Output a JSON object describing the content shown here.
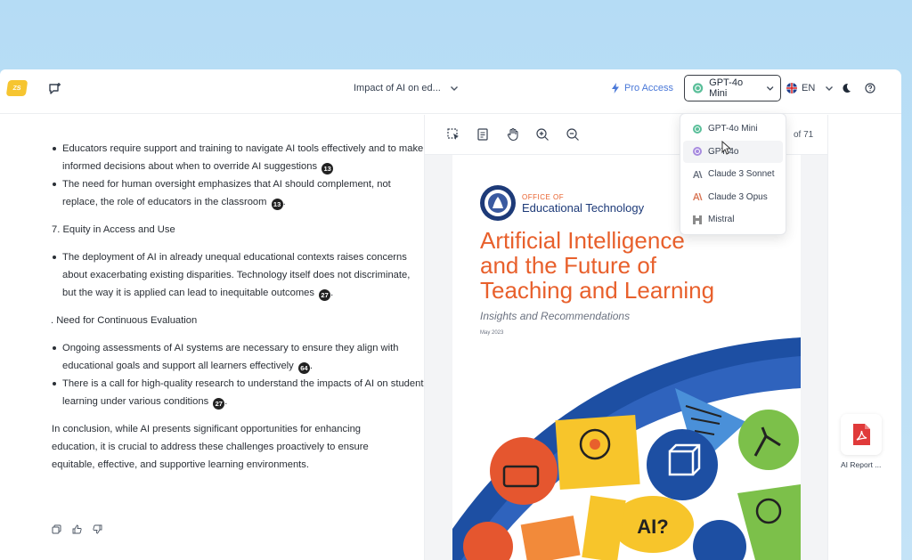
{
  "header": {
    "logo_text": "ZS",
    "conversation_title": "Impact of AI on ed...",
    "pro_access": "Pro Access",
    "model_selected": "GPT-4o Mini",
    "language": "EN"
  },
  "model_menu": {
    "items": [
      {
        "label": "GPT-4o Mini",
        "icon": "openai-icon",
        "color": "#5bbf9a"
      },
      {
        "label": "GPT-4o",
        "icon": "openai-icon",
        "color": "#a78bdf"
      },
      {
        "label": "Claude 3 Sonnet",
        "icon": "anthropic-icon",
        "color": "#6b7280"
      },
      {
        "label": "Claude 3 Opus",
        "icon": "anthropic-icon",
        "color": "#d97757"
      },
      {
        "label": "Mistral",
        "icon": "mistral-icon",
        "color": "#8b8b8b"
      }
    ]
  },
  "chat": {
    "list1": [
      {
        "text": "Educators require support and training to navigate AI tools effectively and to make informed decisions about when to override AI suggestions",
        "cite": "13"
      },
      {
        "text": "The need for human oversight emphasizes that AI should complement, not replace, the role of educators in the classroom",
        "cite": "13"
      }
    ],
    "heading1": "7. Equity in Access and Use",
    "list2": [
      {
        "text": "The deployment of AI in already unequal educational contexts raises concerns about exacerbating existing disparities. Technology itself does not discriminate, but the way it is applied can lead to inequitable outcomes",
        "cite": "27"
      }
    ],
    "heading2": ". Need for Continuous Evaluation",
    "list3": [
      {
        "text": "Ongoing assessments of AI systems are necessary to ensure they align with educational goals and support all learners effectively",
        "cite": "64"
      },
      {
        "text": "There is a call for high-quality research to understand the impacts of AI on student learning under various conditions",
        "cite": "27"
      }
    ],
    "conclusion": "In conclusion, while AI presents significant opportunities for enhancing education, it is crucial to address these challenges proactively to ensure equitable, effective, and supportive learning environments."
  },
  "viewer": {
    "page_count": "of 71"
  },
  "pdf": {
    "office_of": "OFFICE OF",
    "office_name": "Educational Technology",
    "title_line1": "Artificial Intelligence",
    "title_line2": "and the Future of",
    "title_line3": "Teaching and Learning",
    "subtitle": "Insights and Recommendations",
    "date": "May 2023",
    "bubble_text": "AI?"
  },
  "attachment": {
    "label": "AI Report ..."
  },
  "colors": {
    "accent": "#4a78d8",
    "pdf_title": "#e8602c",
    "pdf_blue": "#1d4fa3"
  }
}
